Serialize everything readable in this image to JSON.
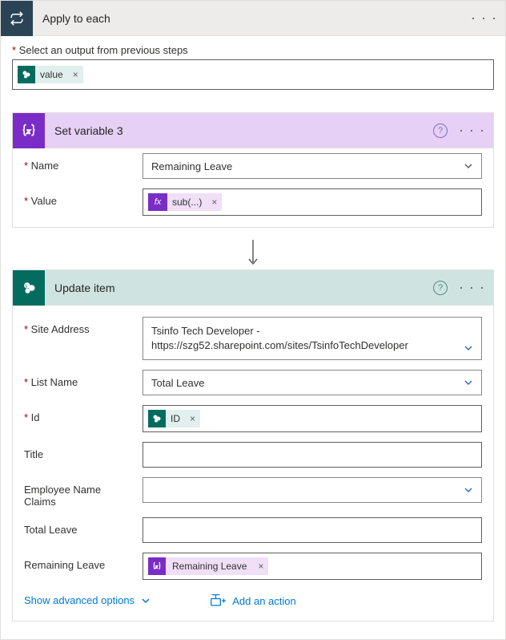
{
  "apply_each": {
    "title": "Apply to each",
    "output_label": "Select an output from previous steps",
    "token_text": "value",
    "token_x": "×"
  },
  "set_var": {
    "title": "Set variable 3",
    "name_label": "Name",
    "name_value": "Remaining Leave",
    "value_label": "Value",
    "fx_icon": "fx",
    "fx_text": "sub(...)",
    "fx_x": "×"
  },
  "update_item": {
    "title": "Update item",
    "site_label": "Site Address",
    "site_line1": "Tsinfo Tech Developer -",
    "site_line2": "https://szg52.sharepoint.com/sites/TsinfoTechDeveloper",
    "list_label": "List Name",
    "list_value": "Total Leave",
    "id_label": "Id",
    "id_token": "ID",
    "id_x": "×",
    "title_label": "Title",
    "emp_label": "Employee Name Claims",
    "total_label": "Total Leave",
    "remain_label": "Remaining Leave",
    "remain_token": "Remaining Leave",
    "remain_x": "×",
    "adv": "Show advanced options"
  },
  "footer": {
    "add": "Add an action"
  },
  "glyph": {
    "help": "?",
    "ellipsis": "· · ·"
  }
}
